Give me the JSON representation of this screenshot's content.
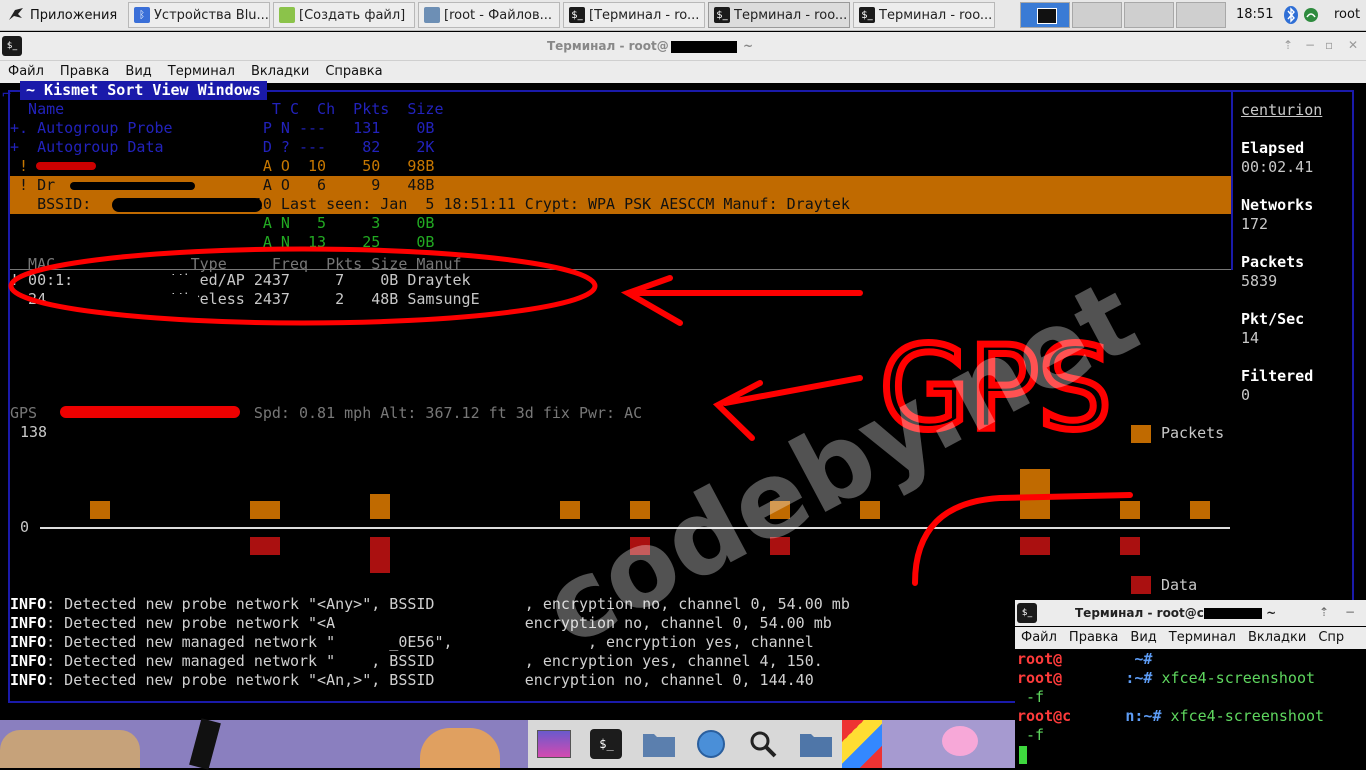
{
  "panel": {
    "apps_label": "Приложения",
    "tasks": [
      {
        "label": "Устройства Blu...",
        "icon": "bluetooth-icon",
        "color": "#3a6fd8"
      },
      {
        "label": "[Создать файл]",
        "icon": "text-editor-icon",
        "color": "#8bc34a"
      },
      {
        "label": "[root - Файлов...",
        "icon": "file-manager-icon",
        "color": "#6d8fb5"
      },
      {
        "label": "[Терминал - ro...",
        "icon": "terminal-icon",
        "color": "#1a1a1a"
      },
      {
        "label": "Терминал - roo...",
        "icon": "terminal-icon",
        "color": "#1a1a1a"
      },
      {
        "label": "Терминал - roo...",
        "icon": "terminal-icon",
        "color": "#1a1a1a"
      }
    ],
    "clock": "18:51",
    "user": "root"
  },
  "window": {
    "title": "Терминал - root@",
    "title_suffix": " ~",
    "menu": [
      "Файл",
      "Правка",
      "Вид",
      "Терминал",
      "Вкладки",
      "Справка"
    ]
  },
  "kismet": {
    "menu": "~ Kismet Sort View Windows",
    "header": "  Name                       T C  Ch  Pkts  Size",
    "rows": [
      {
        "text": "+. Autogroup Probe          P N ---   131    0B",
        "cls": "blue"
      },
      {
        "text": "+  Autogroup Data           D ? ---    82    2K",
        "cls": "blue"
      },
      {
        "text": "                            A O  10    50   98B",
        "cls": "orange",
        "bang": " !"
      },
      {
        "text": "                            A N   5     3    0B",
        "cls": "green"
      },
      {
        "text": "                            A N  13    25    0B",
        "cls": "green"
      }
    ],
    "selected_row": " ! Dr                       A O   6     9   48B",
    "selected_detail": "   BSSID:                 :10 Last seen: Jan  5 18:51:11 Crypt: WPA PSK AESCCM Manuf: Draytek",
    "clients_header": "  MAC               Type     Freq  Pkts Size Manuf",
    "clients": [
      "! 00:1:           Wired/AP 2437     7    0B Draytek",
      "  24.             Wireless 2437     2   48B SamsungE"
    ],
    "gps_line": "GPS                        Spd: 0.81 mph Alt: 367.12 ft 3d fix Pwr: AC",
    "graph_max": "138",
    "graph_zero": "0",
    "legend_packets": "Packets",
    "legend_data": "Data",
    "packets_values": [
      1,
      1,
      2,
      1,
      1,
      1,
      1,
      3,
      1,
      1
    ],
    "data_values": [
      1,
      2,
      1,
      1,
      1,
      1
    ],
    "info_prefix": "INFO",
    "info": [
      ": Detected new probe network \"<Any>\", BSSID          , encryption no, channel 0, 54.00 mb",
      ": Detected new probe network \"<A                     encryption no, channel 0, 54.00 mb",
      ": Detected new managed network \"      _0E56\",               , encryption yes, channel",
      ": Detected new managed network \"    , BSSID          , encryption yes, channel 4, 150.",
      ": Detected new probe network \"<An,>\", BSSID          encryption no, channel 0, 144.40"
    ],
    "sidebar": {
      "hostname": "centurion",
      "stats": [
        {
          "label": "Elapsed",
          "value": "00:02.41"
        },
        {
          "label": "Networks",
          "value": "172"
        },
        {
          "label": "Packets",
          "value": "5839"
        },
        {
          "label": "Pkt/Sec",
          "value": "14"
        },
        {
          "label": "Filtered",
          "value": "0"
        }
      ]
    }
  },
  "overlay": {
    "watermark": "codeby.net",
    "gps_annotation": "GPS"
  },
  "term2": {
    "title": "Терминал - root@c",
    "menu": [
      "Файл",
      "Правка",
      "Вид",
      "Терминал",
      "Вкладки",
      "Спр"
    ],
    "lines": [
      {
        "prompt": "root@",
        "rest": "        ~#",
        "cmd": ""
      },
      {
        "prompt": "root@",
        "rest": "       :~#",
        "cmd": " xfce4-screenshoot"
      },
      {
        "prompt": "",
        "rest": "",
        "cmd": " -f"
      },
      {
        "prompt": "root@c",
        "rest": "      n:~#",
        "cmd": " xfce4-screenshoot"
      },
      {
        "prompt": "",
        "rest": "",
        "cmd": " -f"
      }
    ]
  }
}
